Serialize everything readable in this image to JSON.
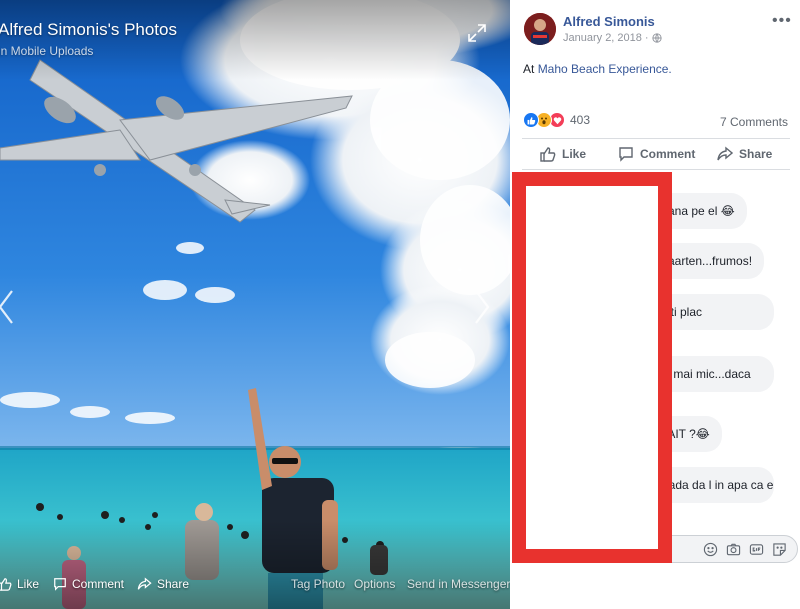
{
  "photo": {
    "album_title": "Alfred Simonis's Photos",
    "album_subtitle": "in Mobile Uploads",
    "actions": {
      "like": "Like",
      "comment": "Comment",
      "share": "Share",
      "tag_photo": "Tag Photo",
      "options": "Options",
      "send_in_messenger": "Send in Messenger"
    },
    "icons": [
      "expand-icon",
      "chevron-left-icon",
      "chevron-right-icon",
      "thumbs-up-icon",
      "comment-icon",
      "share-icon"
    ]
  },
  "post": {
    "author": "Alfred Simonis",
    "date": "January 2, 2018",
    "separator": "·",
    "privacy_icon": "globe-icon",
    "more": "•••",
    "location_prefix": "At",
    "location": "Maho Beach Experience.",
    "reactions": {
      "types": [
        "like",
        "wow",
        "love"
      ],
      "count": "403"
    },
    "comments_count": "7 Comments",
    "actions": {
      "like": "Like",
      "comment": "Comment",
      "share": "Share"
    },
    "comments": [
      {
        "text": "mana pe el 😂"
      },
      {
        "text": "Maarten...frumos!"
      },
      {
        "text": "a iti plac"
      },
      {
        "text": "sti mai mic...daca"
      },
      {
        "text": "a AIT ?😂"
      },
      {
        "text": "roada da l in apa ca e"
      }
    ],
    "comment_box_icons": [
      "emoji-icon",
      "camera-icon",
      "gif-icon",
      "sticker-icon"
    ]
  },
  "colors": {
    "link": "#385898",
    "secondary_text": "#606770",
    "like_blue": "#1877f2",
    "wow_yellow": "#f7b125",
    "love_red": "#f33e58",
    "redaction_red": "#e8322e",
    "bubble_bg": "#f2f3f5"
  }
}
